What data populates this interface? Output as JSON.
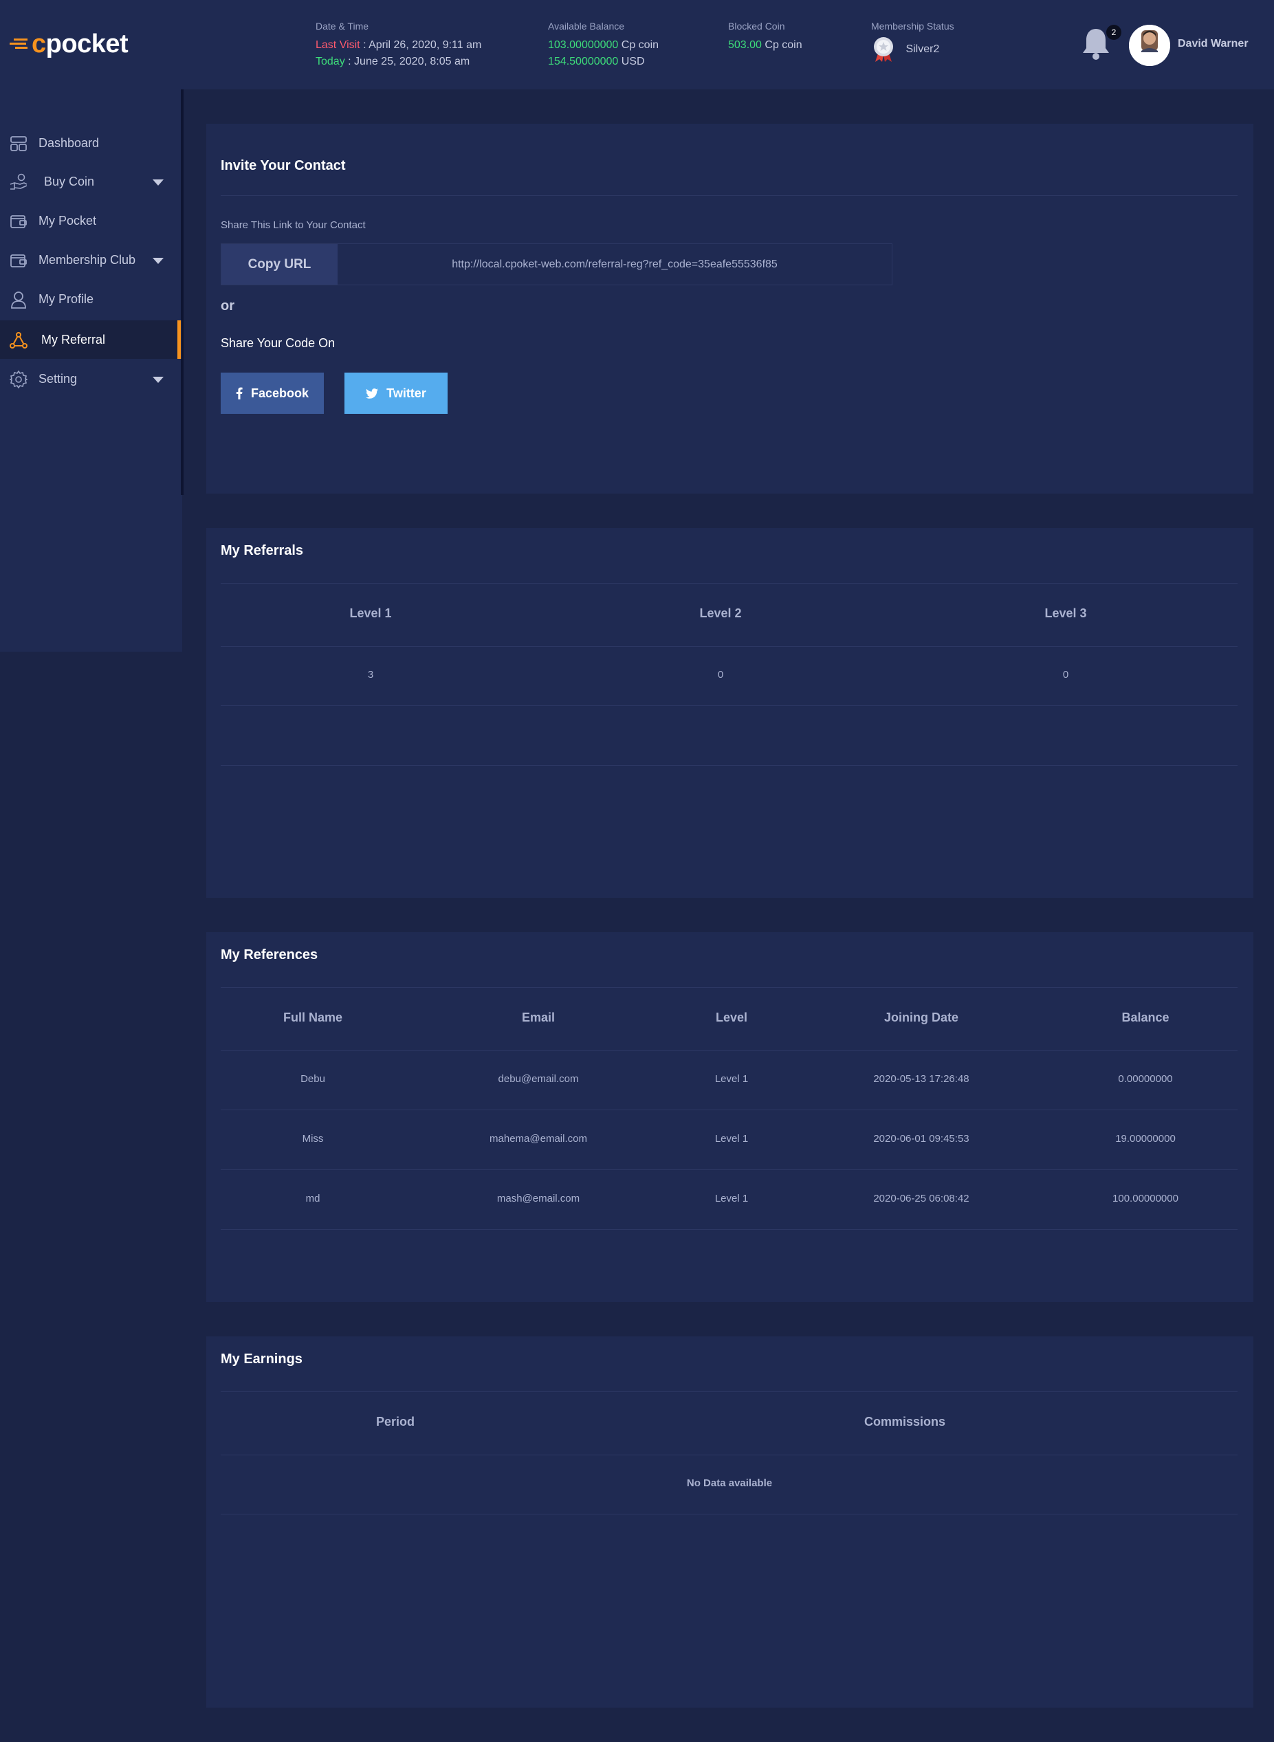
{
  "header": {
    "logo_c": "c",
    "logo_rest": "pocket",
    "datetime": {
      "label": "Date & Time",
      "last_visit_label": "Last Visit",
      "last_visit_value": " : April 26, 2020, 9:11 am",
      "today_label": "Today",
      "today_value": " : June 25, 2020, 8:05 am"
    },
    "balance": {
      "label": "Available Balance",
      "coin_amount": "103.00000000",
      "coin_unit": " Cp coin",
      "usd_amount": "154.50000000",
      "usd_unit": " USD"
    },
    "blocked": {
      "label": "Blocked Coin",
      "amount": "503.00",
      "unit": " Cp coin"
    },
    "membership": {
      "label": "Membership Status",
      "value": "Silver2"
    },
    "notifications_count": "2",
    "user_name": "David Warner"
  },
  "sidebar": {
    "items": [
      {
        "label": "Dashboard",
        "icon": "dashboard-icon"
      },
      {
        "label": "Buy Coin",
        "icon": "buy-coin-icon"
      },
      {
        "label": "My Pocket",
        "icon": "wallet-icon"
      },
      {
        "label": "Membership Club",
        "icon": "membership-icon"
      },
      {
        "label": "My Profile",
        "icon": "user-icon"
      },
      {
        "label": "My Referral",
        "icon": "referral-icon"
      },
      {
        "label": "Setting",
        "icon": "gear-icon"
      }
    ]
  },
  "invite": {
    "title": "Invite Your Contact",
    "share_label": "Share This Link to Your Contact",
    "copy_button": "Copy URL",
    "url": "http://local.cpoket-web.com/referral-reg?ref_code=35eafe55536f85",
    "or": "or",
    "share_code_label": "Share Your Code On",
    "facebook": "Facebook",
    "twitter": "Twitter"
  },
  "referrals": {
    "title": "My Referrals",
    "headers": [
      "Level 1",
      "Level 2",
      "Level 3"
    ],
    "values": [
      "3",
      "0",
      "0"
    ]
  },
  "references": {
    "title": "My References",
    "headers": [
      "Full Name",
      "Email",
      "Level",
      "Joining Date",
      "Balance"
    ],
    "rows": [
      [
        "Debu",
        "debu@email.com",
        "Level 1",
        "2020-05-13 17:26:48",
        "0.00000000"
      ],
      [
        "Miss",
        "mahema@email.com",
        "Level 1",
        "2020-06-01 09:45:53",
        "19.00000000"
      ],
      [
        "md",
        "mash@email.com",
        "Level 1",
        "2020-06-25 06:08:42",
        "100.00000000"
      ]
    ]
  },
  "earnings": {
    "title": "My Earnings",
    "headers": [
      "Period",
      "Commissions"
    ],
    "empty_text": "No Data available"
  },
  "colors": {
    "accent": "#f7931e",
    "positive": "#3ddc7a",
    "alert": "#ff5b6e",
    "facebook": "#3b5998",
    "twitter": "#55acee"
  }
}
